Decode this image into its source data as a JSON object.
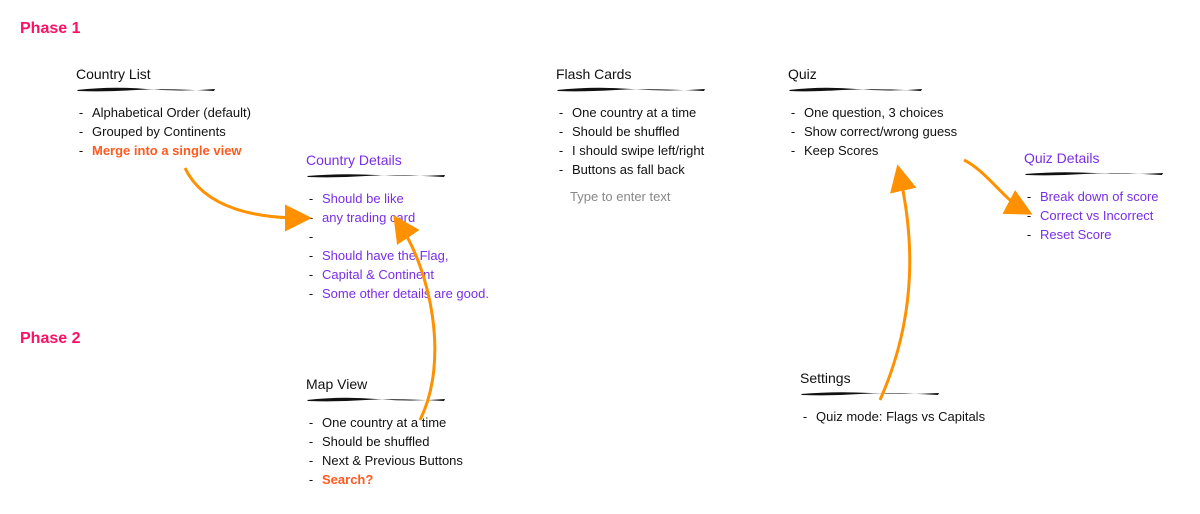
{
  "phases": {
    "phase1_label": "Phase 1",
    "phase2_label": "Phase 2"
  },
  "country_list": {
    "title": "Country List",
    "items": [
      {
        "text": "Alphabetical Order (default)",
        "style": "normal"
      },
      {
        "text": "Grouped by Continents",
        "style": "normal"
      },
      {
        "text": "Merge into a single view",
        "style": "orange"
      }
    ]
  },
  "country_details": {
    "title": "Country Details",
    "items": [
      {
        "text": "Should be like",
        "style": "purple"
      },
      {
        "text": "any trading card",
        "style": "purple"
      },
      {
        "text": "",
        "style": "purple"
      },
      {
        "text": "Should have the Flag,",
        "style": "purple"
      },
      {
        "text": "Capital & Continent",
        "style": "purple"
      },
      {
        "text": "Some other details are good.",
        "style": "purple"
      }
    ]
  },
  "flash_cards": {
    "title": "Flash Cards",
    "items": [
      {
        "text": "One country at a time",
        "style": "normal"
      },
      {
        "text": "Should be shuffled",
        "style": "normal"
      },
      {
        "text": "I should swipe left/right",
        "style": "normal"
      },
      {
        "text": "Buttons as fall back",
        "style": "normal"
      }
    ],
    "placeholder": "Type to enter text"
  },
  "quiz": {
    "title": "Quiz",
    "items": [
      {
        "text": "One question, 3 choices",
        "style": "normal"
      },
      {
        "text": "Show correct/wrong guess",
        "style": "normal"
      },
      {
        "text": "Keep Scores",
        "style": "normal"
      }
    ]
  },
  "quiz_details": {
    "title": "Quiz Details",
    "items": [
      {
        "text": "Break down of score",
        "style": "purple"
      },
      {
        "text": "Correct vs Incorrect",
        "style": "purple"
      },
      {
        "text": "Reset Score",
        "style": "purple"
      }
    ]
  },
  "map_view": {
    "title": "Map View",
    "items": [
      {
        "text": "One country at a time",
        "style": "normal"
      },
      {
        "text": "Should be shuffled",
        "style": "normal"
      },
      {
        "text": "Next & Previous Buttons",
        "style": "normal"
      },
      {
        "text": "Search?",
        "style": "orange"
      }
    ]
  },
  "settings": {
    "title": "Settings",
    "items": [
      {
        "text": "Quiz mode: Flags vs Capitals",
        "style": "normal"
      }
    ]
  },
  "colors": {
    "phase": "#ff1066",
    "orange": "#ff5a1f",
    "purple": "#7a2ee6",
    "arrow": "#ff9000"
  }
}
